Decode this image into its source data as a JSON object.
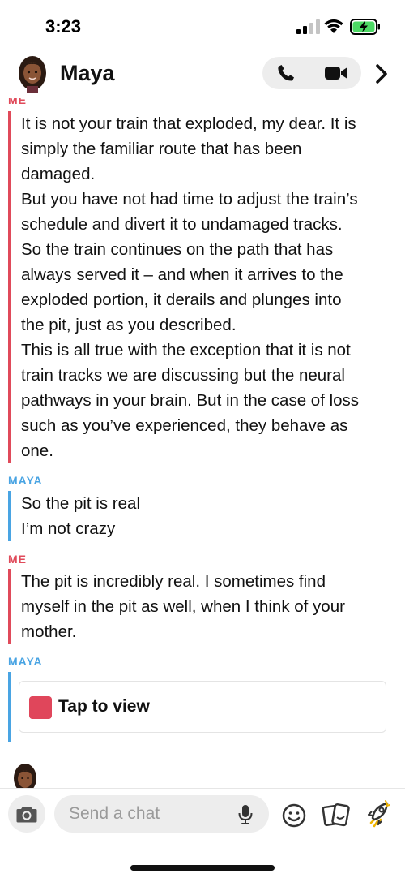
{
  "status_bar": {
    "time": "3:23"
  },
  "header": {
    "contact_name": "Maya",
    "icons": [
      "avatar",
      "phone-icon",
      "video-camera-icon",
      "chevron-right-icon"
    ]
  },
  "messages": [
    {
      "sender": "ME",
      "lines": [
        "It is not your train that exploded, my dear. It is",
        "simply the familiar route that has been",
        "damaged.",
        "But you have not had time to adjust the train’s",
        "schedule and divert it to undamaged tracks.",
        "So the train continues on the path that has",
        "always served it – and when it arrives to the",
        "exploded portion, it derails and plunges into",
        "the pit, just as you described.",
        "This is all true with the exception that it is not",
        "train tracks we are discussing but the neural",
        "pathways in your brain. But in the case of loss",
        "such as you’ve experienced, they behave as",
        "one."
      ]
    },
    {
      "sender": "MAYA",
      "lines": [
        "So the pit is real",
        "I’m not crazy"
      ]
    },
    {
      "sender": "ME",
      "lines": [
        "The pit is incredibly real. I sometimes find",
        "myself in the pit as well, when I think of your",
        "mother."
      ]
    },
    {
      "sender": "MAYA",
      "snap_label": "Tap to view"
    }
  ],
  "composer": {
    "placeholder": "Send a chat",
    "icons": [
      "camera-icon",
      "microphone-icon",
      "smiley-icon",
      "stickers-icon",
      "rocket-icon"
    ]
  },
  "colors": {
    "me_accent": "#e04a5a",
    "maya_accent": "#49a4e3",
    "snap_red": "#e0465b"
  }
}
